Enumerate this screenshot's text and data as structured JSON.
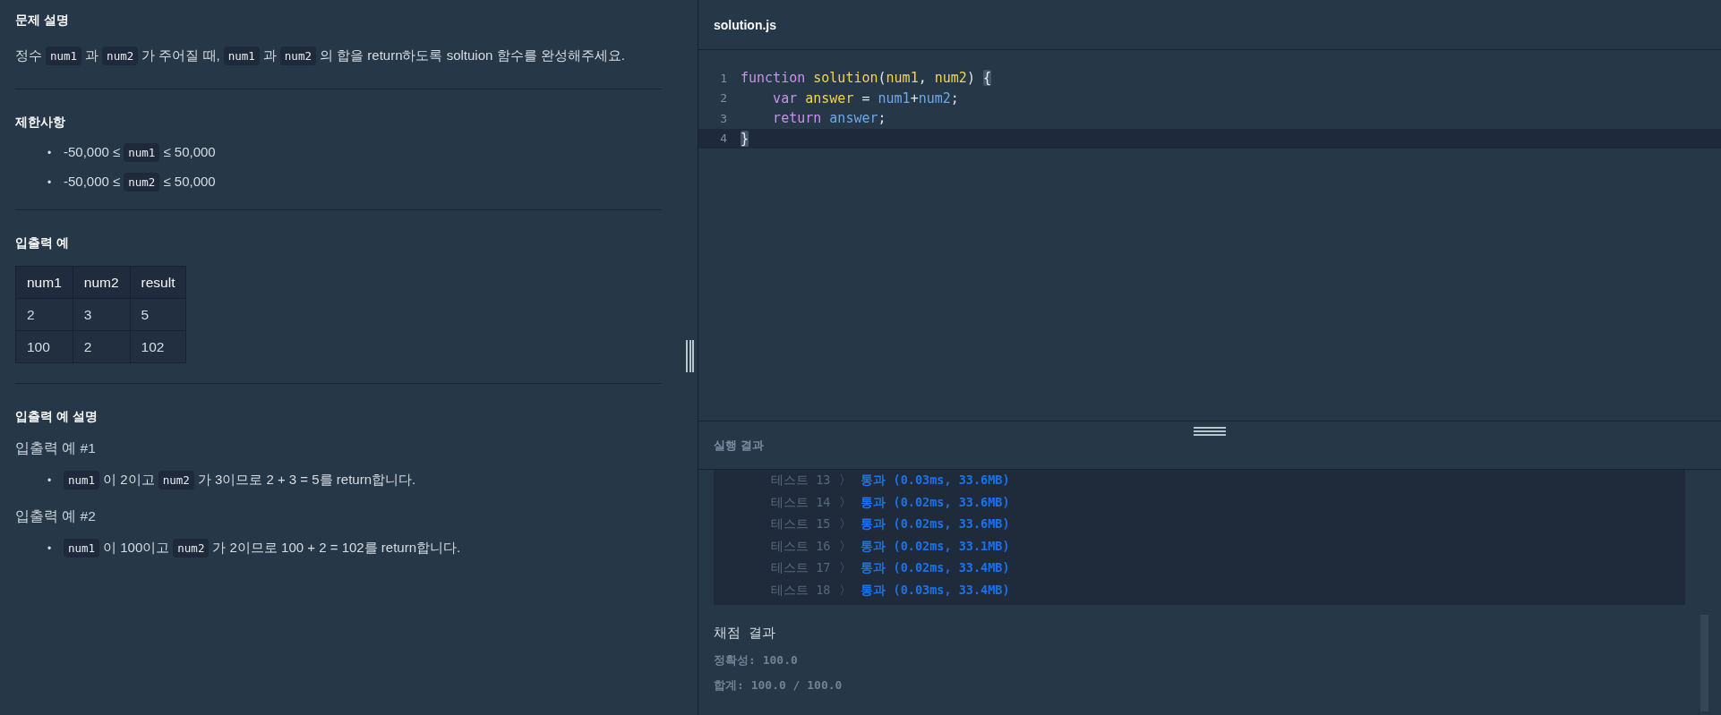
{
  "description": {
    "title": "문제 설명",
    "paragraph": [
      {
        "kind": "text",
        "text": "정수"
      },
      {
        "kind": "code",
        "text": "num1"
      },
      {
        "kind": "text",
        "text": "과"
      },
      {
        "kind": "code",
        "text": "num2"
      },
      {
        "kind": "text",
        "text": "가 주어질 때,"
      },
      {
        "kind": "code",
        "text": "num1"
      },
      {
        "kind": "text",
        "text": "과"
      },
      {
        "kind": "code",
        "text": "num2"
      },
      {
        "kind": "text",
        "text": "의 합을 return하도록 soltuion 함수를 완성해주세요."
      }
    ]
  },
  "constraints": {
    "title": "제한사항",
    "items": [
      {
        "bullet": "•",
        "segments": [
          {
            "kind": "text",
            "text": "-50,000 ≤"
          },
          {
            "kind": "code",
            "text": "num1"
          },
          {
            "kind": "text",
            "text": "≤ 50,000"
          }
        ]
      },
      {
        "bullet": "•",
        "segments": [
          {
            "kind": "text",
            "text": "-50,000 ≤"
          },
          {
            "kind": "code",
            "text": "num2"
          },
          {
            "kind": "text",
            "text": "≤ 50,000"
          }
        ]
      }
    ]
  },
  "examples": {
    "title": "입출력 예",
    "table": {
      "columns": [
        "num1",
        "num2",
        "result"
      ],
      "rows": [
        [
          "2",
          "3",
          "5"
        ],
        [
          "100",
          "2",
          "102"
        ]
      ]
    }
  },
  "explanation": {
    "title": "입출력 예 설명",
    "cases": [
      {
        "label": "입출력 예 #1",
        "items": [
          {
            "bullet": "•",
            "segments": [
              {
                "kind": "code",
                "text": "num1"
              },
              {
                "kind": "text",
                "text": "이 2이고"
              },
              {
                "kind": "code",
                "text": "num2"
              },
              {
                "kind": "text",
                "text": "가 3이므로 2 + 3 = 5를 return합니다."
              }
            ]
          }
        ]
      },
      {
        "label": "입출력 예 #2",
        "items": [
          {
            "bullet": "•",
            "segments": [
              {
                "kind": "code",
                "text": "num1"
              },
              {
                "kind": "text",
                "text": "이 100이고"
              },
              {
                "kind": "code",
                "text": "num2"
              },
              {
                "kind": "text",
                "text": "가 2이므로 100 + 2 = 102를 return합니다."
              }
            ]
          }
        ]
      }
    ]
  },
  "editor": {
    "filename": "solution.js",
    "lines": [
      {
        "number": "1",
        "current": false,
        "tokens": [
          {
            "kind": "keyword",
            "text": "function "
          },
          {
            "kind": "name",
            "text": "solution"
          },
          {
            "kind": "plain",
            "text": "("
          },
          {
            "kind": "name",
            "text": "num1"
          },
          {
            "kind": "plain",
            "text": ", "
          },
          {
            "kind": "name",
            "text": "num2"
          },
          {
            "kind": "plain",
            "text": ") "
          },
          {
            "kind": "match",
            "text": "{"
          }
        ]
      },
      {
        "number": "2",
        "current": false,
        "tokens": [
          {
            "kind": "indent"
          },
          {
            "kind": "keyword",
            "text": "var "
          },
          {
            "kind": "name",
            "text": "answer"
          },
          {
            "kind": "plain",
            "text": " = "
          },
          {
            "kind": "variable",
            "text": "num1"
          },
          {
            "kind": "plain",
            "text": "+"
          },
          {
            "kind": "variable",
            "text": "num2"
          },
          {
            "kind": "plain",
            "text": ";"
          }
        ]
      },
      {
        "number": "3",
        "current": false,
        "tokens": [
          {
            "kind": "indent"
          },
          {
            "kind": "keyword",
            "text": "return "
          },
          {
            "kind": "variable",
            "text": "answer"
          },
          {
            "kind": "plain",
            "text": ";"
          }
        ]
      },
      {
        "number": "4",
        "current": true,
        "tokens": [
          {
            "kind": "match",
            "text": "}"
          }
        ]
      }
    ]
  },
  "results": {
    "title": "실행 결과",
    "tests": [
      {
        "label": "테스트 13",
        "separator": "〉",
        "status": "통과",
        "detail": "(0.03ms, 33.6MB)"
      },
      {
        "label": "테스트 14",
        "separator": "〉",
        "status": "통과",
        "detail": "(0.02ms, 33.6MB)"
      },
      {
        "label": "테스트 15",
        "separator": "〉",
        "status": "통과",
        "detail": "(0.02ms, 33.6MB)"
      },
      {
        "label": "테스트 16",
        "separator": "〉",
        "status": "통과",
        "detail": "(0.02ms, 33.1MB)"
      },
      {
        "label": "테스트 17",
        "separator": "〉",
        "status": "통과",
        "detail": "(0.02ms, 33.4MB)"
      },
      {
        "label": "테스트 18",
        "separator": "〉",
        "status": "통과",
        "detail": "(0.03ms, 33.4MB)"
      }
    ],
    "grading": {
      "title": "채점 결과",
      "accuracy": "정확성: 100.0",
      "total": "합계: 100.0 / 100.0"
    }
  }
}
